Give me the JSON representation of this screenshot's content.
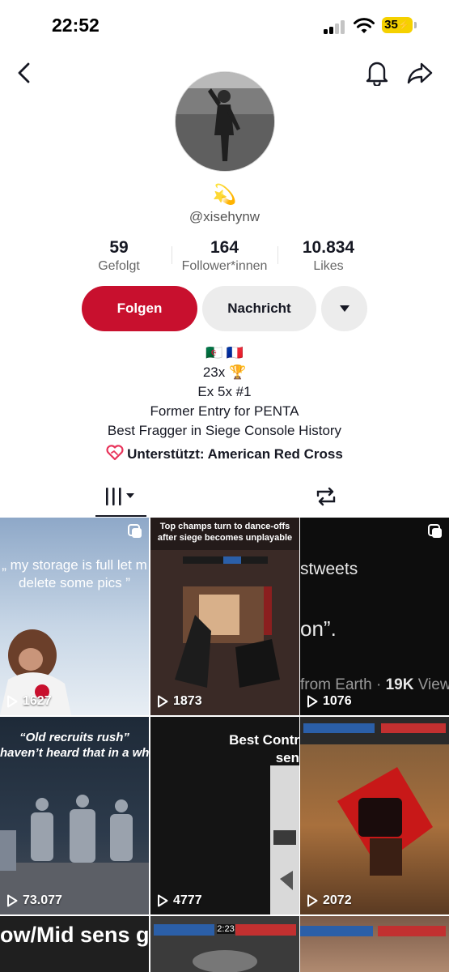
{
  "status_bar": {
    "time": "22:52",
    "battery": "35"
  },
  "profile": {
    "emoji": "💫",
    "username": "@xisehynw"
  },
  "stats": [
    {
      "value": "59",
      "label": "Gefolgt"
    },
    {
      "value": "164",
      "label": "Follower*innen"
    },
    {
      "value": "10.834",
      "label": "Likes"
    }
  ],
  "actions": {
    "follow": "Folgen",
    "message": "Nachricht"
  },
  "bio": [
    "🇩🇿 🇫🇷",
    "23x 🏆",
    "Ex 5x #1",
    "Former Entry for PENTA",
    "Best Fragger in Siege Console History"
  ],
  "support": "Unterstützt: American Red Cross",
  "videos": [
    {
      "views": "1627",
      "caption": "„ my storage is full let m\ndelete some pics ”"
    },
    {
      "views": "1873",
      "caption": "Top champs turn to dance-offs\nafter siege becomes unplayable"
    },
    {
      "views": "1076",
      "caption_top": "stweets",
      "caption_mid": "on”.",
      "caption_low_a": "from Earth · ",
      "caption_low_b": "19K",
      "caption_low_c": " View"
    },
    {
      "views": "73.077",
      "caption": "“Old recruits rush”\nhaven’t heard that in a whil"
    },
    {
      "views": "4777",
      "caption": "Best Contr\nsen"
    },
    {
      "views": "2072"
    },
    {
      "caption": "ow/Mid sens g"
    },
    {
      "hud": "2:23"
    },
    {}
  ],
  "colors": {
    "accent": "#c8102e",
    "secondary_button": "#ececec",
    "text": "#161823"
  }
}
